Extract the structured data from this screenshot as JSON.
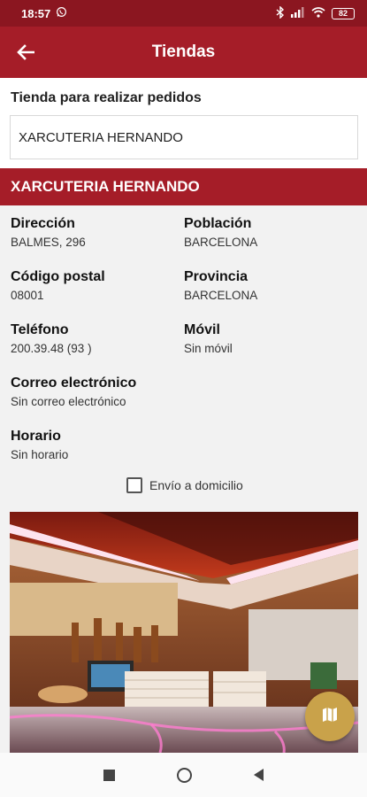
{
  "status_bar": {
    "time": "18:57",
    "battery": "82"
  },
  "app_bar": {
    "title": "Tiendas"
  },
  "selector": {
    "label": "Tienda para realizar pedidos",
    "value": "XARCUTERIA HERNANDO"
  },
  "store": {
    "name": "XARCUTERIA HERNANDO",
    "fields": {
      "direccion": {
        "label": "Dirección",
        "value": "BALMES, 296"
      },
      "poblacion": {
        "label": "Población",
        "value": "BARCELONA"
      },
      "codigo_postal": {
        "label": "Código postal",
        "value": "08001"
      },
      "provincia": {
        "label": "Provincia",
        "value": "BARCELONA"
      },
      "telefono": {
        "label": "Teléfono",
        "value": "200.39.48 (93 )"
      },
      "movil": {
        "label": "Móvil",
        "value": "Sin móvil"
      },
      "correo": {
        "label": "Correo electrónico",
        "value": "Sin correo electrónico"
      },
      "horario": {
        "label": "Horario",
        "value": "Sin horario"
      }
    },
    "delivery": {
      "label": "Envío a domicilio",
      "checked": false
    }
  },
  "colors": {
    "primary": "#a51d28",
    "status": "#8b1620",
    "fab": "#c9a24a"
  },
  "icons": {
    "back": "arrow-left-icon",
    "map": "map-icon",
    "whatsapp": "whatsapp-icon"
  }
}
